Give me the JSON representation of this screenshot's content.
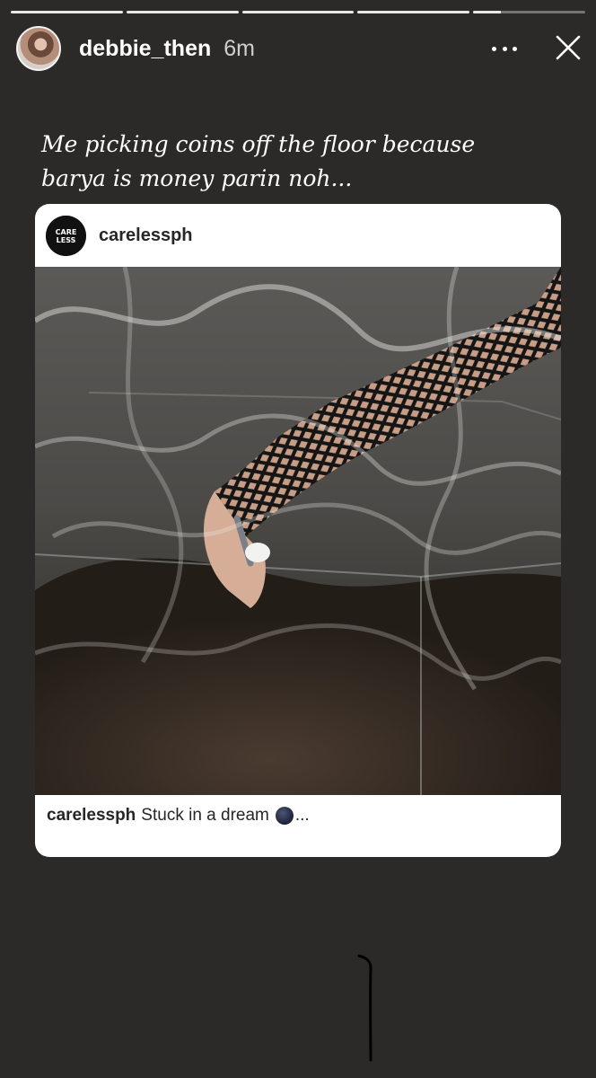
{
  "story": {
    "progress": [
      1,
      1,
      1,
      1,
      0.25
    ],
    "username": "debbie_then",
    "time": "6m",
    "caption": "Me picking coins off the floor because\nbarya is money parin noh...",
    "icons": {
      "more": "more-options-icon",
      "close": "close-icon",
      "avatar": "profile-avatar"
    }
  },
  "post": {
    "username": "carelessph",
    "caption_handle": "carelessph",
    "caption_text": "Stuck in a dream",
    "caption_emoji": "new-moon-emoji",
    "ellipsis": "...",
    "logo_text": "CARE LESS"
  }
}
